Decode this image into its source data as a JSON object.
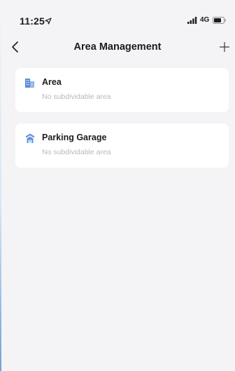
{
  "status_bar": {
    "time": "11:25",
    "network": "4G",
    "icons": [
      "location-arrow-icon",
      "signal-icon",
      "battery-icon"
    ]
  },
  "nav": {
    "title": "Area Management",
    "back_icon": "chevron-left-icon",
    "add_icon": "plus-icon"
  },
  "areas": [
    {
      "name": "Area",
      "subtitle": "No subdividable area",
      "icon": "building-icon"
    },
    {
      "name": "Parking Garage",
      "subtitle": "No subdividable area",
      "icon": "garage-icon"
    }
  ],
  "colors": {
    "background": "#f4f4f6",
    "card": "#ffffff",
    "accent": "#5b8fd9",
    "subtitle_text": "#b9b9be"
  }
}
